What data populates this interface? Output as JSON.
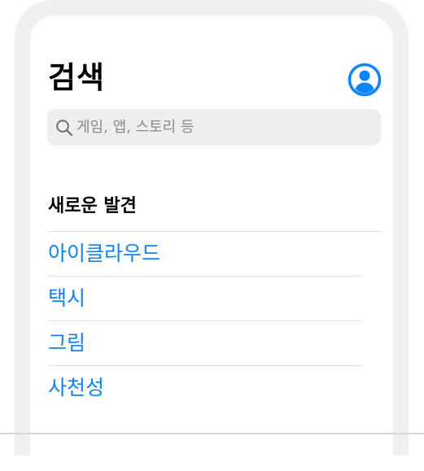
{
  "header": {
    "title": "검색",
    "account_icon": "person-circle-icon"
  },
  "search": {
    "placeholder": "게임, 앱, 스토리 등",
    "icon": "search-icon"
  },
  "discover": {
    "title": "새로운 발견",
    "items": [
      {
        "label": "아이클라우드"
      },
      {
        "label": "택시"
      },
      {
        "label": "그림"
      },
      {
        "label": "사천성"
      }
    ]
  },
  "colors": {
    "accent": "#0a84ff",
    "frame": "#f0f0f2",
    "search_bg": "#eeeeef",
    "placeholder": "#8a8a8e"
  }
}
